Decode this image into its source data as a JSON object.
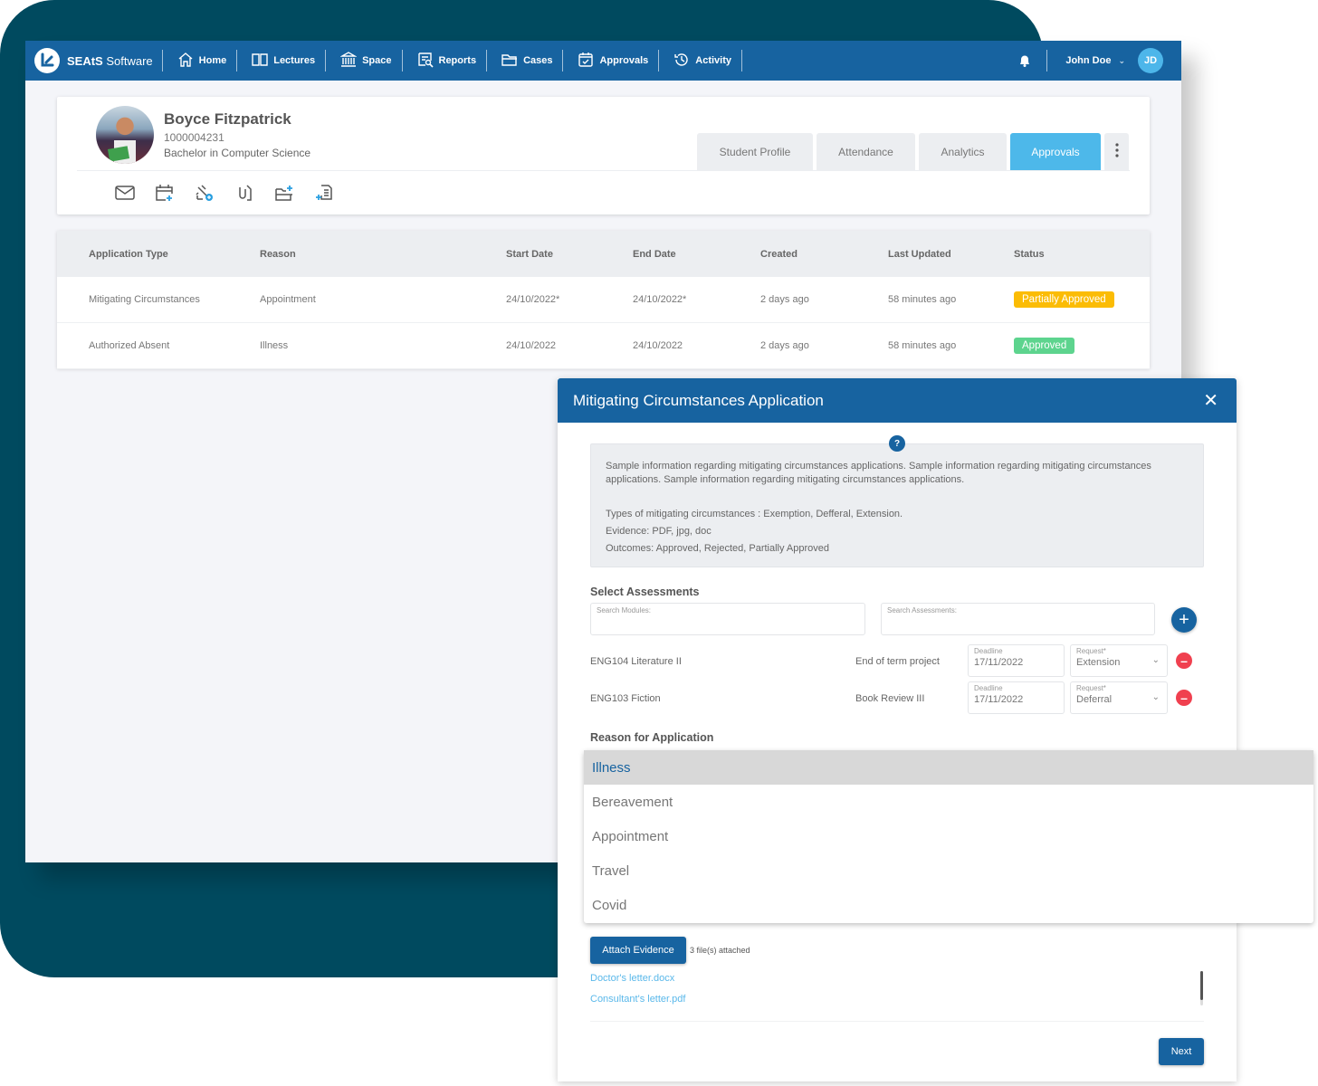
{
  "nav": {
    "brand_bold": "SEAtS",
    "brand_rest": " Software",
    "items": [
      {
        "label": "Home",
        "icon": "home-icon"
      },
      {
        "label": "Lectures",
        "icon": "book-icon"
      },
      {
        "label": "Space",
        "icon": "building-icon"
      },
      {
        "label": "Reports",
        "icon": "report-icon"
      },
      {
        "label": "Cases",
        "icon": "folder-icon"
      },
      {
        "label": "Approvals",
        "icon": "calendar-check-icon"
      },
      {
        "label": "Activity",
        "icon": "history-icon"
      }
    ],
    "user_name": "John Doe",
    "user_initials": "JD"
  },
  "profile": {
    "name": "Boyce Fitzpatrick",
    "id": "1000004231",
    "degree": "Bachelor in Computer Science",
    "actions": [
      "mail-icon",
      "calendar-add-icon",
      "pin-add-icon",
      "attachment-icon",
      "folder-add-icon",
      "document-add-icon"
    ],
    "tabs": [
      "Student Profile",
      "Attendance",
      "Analytics",
      "Approvals"
    ],
    "active_tab": "Approvals"
  },
  "table": {
    "headers": [
      "Application Type",
      "Reason",
      "Start Date",
      "End Date",
      "Created",
      "Last Updated",
      "Status"
    ],
    "rows": [
      [
        "Mitigating Circumstances",
        "Appointment",
        "24/10/2022*",
        "24/10/2022*",
        "2 days ago",
        "58 minutes ago",
        "Partially Approved"
      ],
      [
        "Authorized Absent",
        "Illness",
        "24/10/2022",
        "24/10/2022",
        "2 days ago",
        "58 minutes ago",
        "Approved"
      ]
    ],
    "status_colors": {
      "Partially Approved": "#fbbc05",
      "Approved": "#5dd48e"
    }
  },
  "modal": {
    "title": "Mitigating Circumstances Application",
    "info_icon": "?",
    "info_paragraph": "Sample information regarding mitigating circumstances applications. Sample information regarding mitigating circumstances applications. Sample information regarding mitigating circumstances applications.",
    "info_types": "Types of mitigating circumstances : Exemption, Defferal, Extension.",
    "info_evidence": "Evidence: PDF, jpg, doc",
    "info_outcomes": "Outcomes: Approved, Rejected, Partially Approved",
    "select_assessments_label": "Select Assessments",
    "search_modules_placeholder": "Search Modules:",
    "search_assessments_placeholder": "Search Assessments:",
    "assessments": [
      {
        "module": "ENG104 Literature II",
        "assessment": "End of term project",
        "deadline_label": "Deadline",
        "deadline": "17/11/2022",
        "request_label": "Request*",
        "request": "Extension"
      },
      {
        "module": "ENG103 Fiction",
        "assessment": "Book Review III",
        "deadline_label": "Deadline",
        "deadline": "17/11/2022",
        "request_label": "Request*",
        "request": "Deferral"
      }
    ],
    "reason_label": "Reason for Application",
    "reason_options": [
      "Illness",
      "Bereavement",
      "Appointment",
      "Travel",
      "Covid"
    ],
    "reason_selected": "Illness",
    "attach_label": "Attach Evidence",
    "attach_count": "3 file(s) attached",
    "files": [
      "Doctor's letter.docx",
      "Consultant's letter.pdf"
    ],
    "next_label": "Next"
  }
}
